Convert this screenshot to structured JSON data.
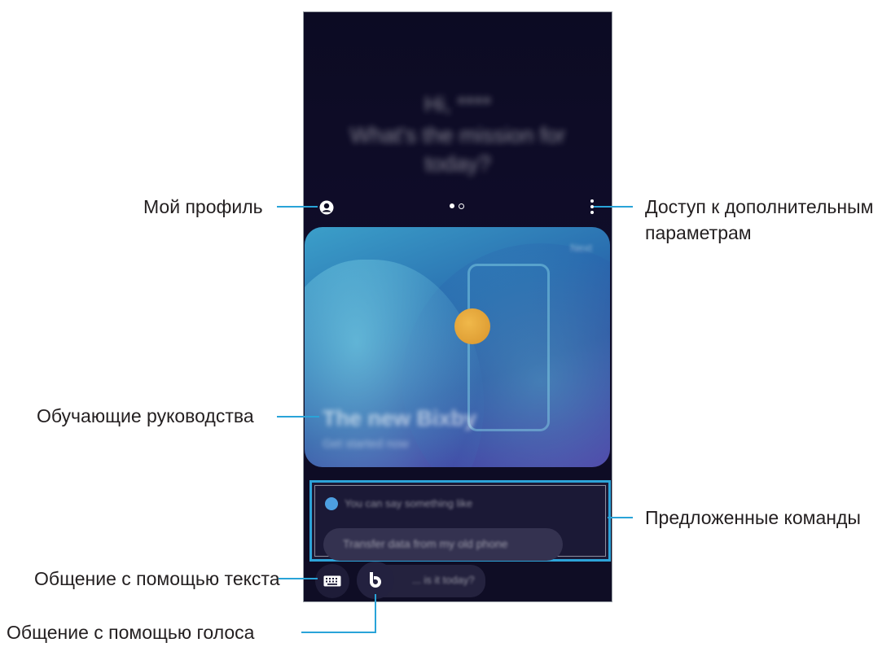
{
  "callouts": {
    "my_profile": "Мой профиль",
    "more_options_line1": "Доступ к дополнительным",
    "more_options_line2": "параметрам",
    "tutorials": "Обучающие руководства",
    "suggested_commands": "Предложенные команды",
    "text_chat": "Общение с помощью текста",
    "voice_chat": "Общение с помощью голоса"
  },
  "phone": {
    "greeting_line1": "Hi, ****",
    "greeting_line2": "What's the mission for",
    "greeting_line3": "today?",
    "page_indicator": {
      "count": 2,
      "active": 1
    },
    "card": {
      "corner_label": "Next",
      "title": "The new Bixby",
      "subtitle": "Get started now"
    },
    "suggestions": {
      "hint": "You can say something like",
      "chip": "Transfer data from my old phone"
    },
    "bottom_chip": "... is it today?"
  },
  "colors": {
    "accent_line": "#29a3d8",
    "phone_bg": "#0c0b23",
    "highlight_border": "#2da4d9"
  },
  "icons": {
    "profile": "profile-icon",
    "more": "more-vertical-icon",
    "keyboard": "keyboard-icon",
    "bixby": "bixby-icon"
  }
}
